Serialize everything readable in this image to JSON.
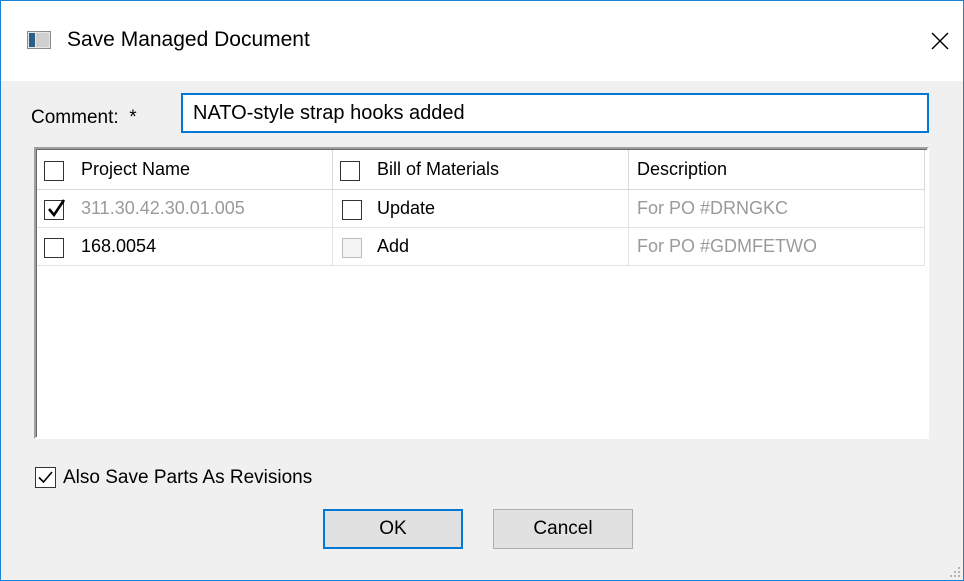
{
  "window": {
    "title": "Save Managed Document",
    "icon": "app-window-icon",
    "close_icon": "close-icon"
  },
  "comment": {
    "label": "Comment:",
    "required_marker": "*",
    "value": "NATO-style strap hooks added"
  },
  "grid": {
    "columns": [
      {
        "label": "Project Name",
        "has_checkbox": true,
        "checked": false
      },
      {
        "label": "Bill of Materials",
        "has_checkbox": true,
        "checked": false
      },
      {
        "label": "Description",
        "has_checkbox": false
      }
    ],
    "rows": [
      {
        "project_checked": true,
        "project_name": "311.30.42.30.01.005",
        "project_grayed": true,
        "bom_checked": false,
        "bom_enabled": true,
        "bom_action": "Update",
        "description": "For PO #DRNGKC"
      },
      {
        "project_checked": false,
        "project_name": "168.0054",
        "project_grayed": false,
        "bom_checked": false,
        "bom_enabled": false,
        "bom_action": "Add",
        "description": "For PO #GDMFETWO"
      }
    ]
  },
  "options": {
    "also_save_label": "Also Save Parts As Revisions",
    "also_save_checked": true
  },
  "buttons": {
    "ok_label": "OK",
    "cancel_label": "Cancel"
  },
  "colors": {
    "accent": "#0078d7",
    "window_border": "#1883d7",
    "dialog_bg": "#f0f0f0",
    "grayed_text": "#9a9a9a"
  }
}
